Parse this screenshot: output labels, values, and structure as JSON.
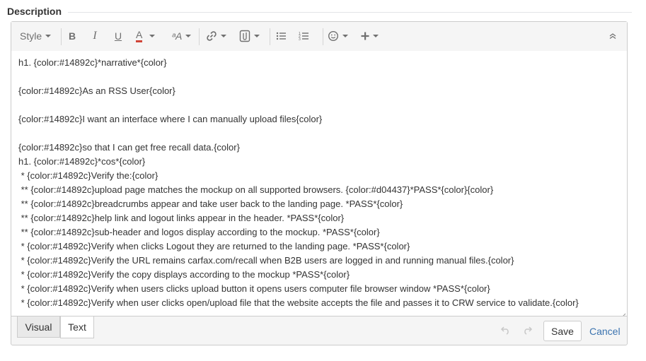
{
  "section": {
    "title": "Description"
  },
  "toolbar": {
    "style_label": "Style",
    "bold": "B",
    "italic": "I",
    "underline": "U",
    "text_color": "A",
    "text_color_swatch": "#d04437",
    "formatting": "ᵃA"
  },
  "content": {
    "lines": [
      "h1. {color:#14892c}*narrative*{color}",
      "",
      "{color:#14892c}As an RSS User{color}",
      "",
      "{color:#14892c}I want an interface where I can manually upload files{color}",
      "",
      "{color:#14892c}so that I can get free recall data.{color}",
      "h1. {color:#14892c}*cos*{color}",
      " * {color:#14892c}Verify the:{color}",
      " ** {color:#14892c}upload page matches the mockup on all supported browsers. {color:#d04437}*PASS*{color}{color}",
      " ** {color:#14892c}breadcrumbs appear and take user back to the landing page. *PASS*{color}",
      " ** {color:#14892c}help link and logout links appear in the header. *PASS*{color}",
      " ** {color:#14892c}sub-header and logos display according to the mockup. *PASS*{color}",
      " * {color:#14892c}Verify when clicks Logout they are returned to the landing page. *PASS*{color}",
      " * {color:#14892c}Verify the URL remains carfax.com/recall when B2B users are logged in and running manual files.{color}",
      " * {color:#14892c}Verify the copy displays according to the mockup *PASS*{color}",
      " * {color:#14892c}Verify when users clicks upload button it opens users computer file browser window *PASS*{color}",
      " * {color:#14892c}Verify when user clicks open/upload file that the website accepts the file and passes it to CRW service to validate.{color}"
    ]
  },
  "footer": {
    "tab_visual": "Visual",
    "tab_text": "Text",
    "save_label": "Save",
    "cancel_label": "Cancel"
  },
  "colors": {
    "link": "#3b73af",
    "border": "#cccccc",
    "toolbar_bg": "#f5f5f5"
  }
}
